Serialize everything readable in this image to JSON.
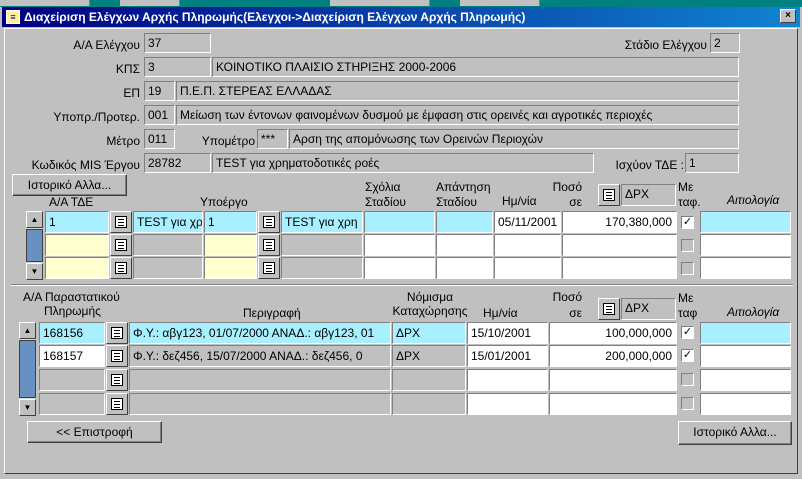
{
  "window": {
    "title": "Διαχείριση Ελέγχων Αρχής Πληρωμής(Ελεγχοι->Διαχείριση Ελέγχων  Αρχής Πληρωμής)"
  },
  "header": {
    "aa_label": "Α/Α Ελέγχου",
    "aa_value": "37",
    "stage_label": "Στάδιο Ελέγχου",
    "stage_value": "2",
    "kps_label": "ΚΠΣ",
    "kps_code": "3",
    "kps_desc": "ΚΟΙΝΟΤΙΚΟ ΠΛΑΙΣΙΟ ΣΤΗΡΙΞΗΣ 2000-2006",
    "ep_label": "ΕΠ",
    "ep_code": "19",
    "ep_desc": "Π.Ε.Π. ΣΤΕΡΕΑΣ ΕΛΛΑΔΑΣ",
    "priority_label": "Υποπρ./Προτερ.",
    "priority_code": "001",
    "priority_desc": "Μείωση των έντονων φαινομένων δυσμού με έμφαση στις ορεινές και αγροτικές περιοχές",
    "measure_label": "Μέτρο",
    "measure_code": "011",
    "submeasure_label": "Υπομέτρο",
    "submeasure_code": "***",
    "submeasure_desc": "Αρση της απομόνωσης των Ορεινών Περιοχών",
    "mis_label": "Κωδικός MIS Έργου",
    "mis_code": "28782",
    "mis_desc": "TEST για χρηματοδοτικές ροές",
    "tde_label": "Ισχύον ΤΔΕ :",
    "tde_value": "1",
    "history_button": "Ιστορικό Αλλα..."
  },
  "block1": {
    "col_aa_tde": "Α/Α ΤΔΕ",
    "col_subproject": "Υποέργο",
    "col_comments": "Σχόλια Σταδίου",
    "col_answer": "Απάντηση Σταδίου",
    "col_date": "Ημ/νία",
    "col_amount": "Ποσό σε",
    "currency": "ΔΡΧ",
    "col_transferred": "Με ταφ.",
    "col_justification": "Αιτιολογία",
    "rows": [
      {
        "aa": "1",
        "tde_desc": "TEST για χρ",
        "sub": "1",
        "sub_desc": "TEST για χρη",
        "comments": "",
        "answer": "",
        "date": "05/11/2001",
        "amount": "170,380,000",
        "checked": "✓"
      },
      {
        "aa": "",
        "tde_desc": "",
        "sub": "",
        "sub_desc": "",
        "comments": "",
        "answer": "",
        "date": "",
        "amount": "",
        "checked": ""
      },
      {
        "aa": "",
        "tde_desc": "",
        "sub": "",
        "sub_desc": "",
        "comments": "",
        "answer": "",
        "date": "",
        "amount": "",
        "checked": ""
      }
    ]
  },
  "block2": {
    "col_aa": "Α/Α Παραστατικού Πληρωμής",
    "col_aa_1": "Α/Α Παραστατικού",
    "col_aa_2": "Πληρωμής",
    "col_desc": "Περιγραφή",
    "col_currency_1": "Νόμισμα",
    "col_currency_2": "Καταχώρησης",
    "col_date": "Ημ/νία",
    "col_amount_1": "Ποσό",
    "col_amount_2": "σε",
    "currency": "ΔΡΧ",
    "col_transferred_1": "Με",
    "col_transferred_2": "ταφ",
    "col_justification": "Αιτιολογία",
    "rows": [
      {
        "aa": "168156",
        "desc": "Φ.Υ.: αβγ123, 01/07/2000  ΑΝΑΔ.: αβγ123, 01",
        "cur": "ΔΡΧ",
        "date": "15/10/2001",
        "amount": "100,000,000",
        "checked": "✓"
      },
      {
        "aa": "168157",
        "desc": "Φ.Υ.: δεζ456, 15/07/2000  ΑΝΑΔ.: δεζ456, 0",
        "cur": "ΔΡΧ",
        "date": "15/01/2001",
        "amount": "200,000,000",
        "checked": "✓"
      },
      {
        "aa": "",
        "desc": "",
        "cur": "",
        "date": "",
        "amount": "",
        "checked": ""
      },
      {
        "aa": "",
        "desc": "",
        "cur": "",
        "date": "",
        "amount": "",
        "checked": ""
      }
    ]
  },
  "footer": {
    "back_button": "<< Επιστροφή",
    "history_button": "Ιστορικό Αλλα..."
  }
}
